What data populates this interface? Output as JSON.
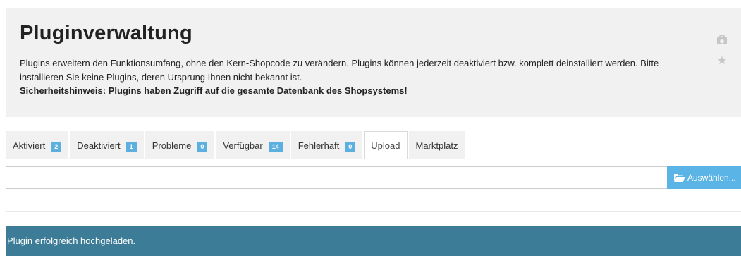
{
  "header": {
    "title": "Pluginverwaltung",
    "description": "Plugins erweitern den Funktionsumfang, ohne den Kern-Shopcode zu verändern. Plugins können jederzeit deaktiviert bzw. komplett deinstalliert werden. Bitte installieren Sie keine Plugins, deren Ursprung Ihnen nicht bekannt ist.",
    "warning": "Sicherheitshinweis: Plugins haben Zugriff auf die gesamte Datenbank des Shopsystems!",
    "icons": [
      "help-icon",
      "star-icon"
    ]
  },
  "tabs": [
    {
      "label": "Aktiviert",
      "count": "2"
    },
    {
      "label": "Deaktiviert",
      "count": "1"
    },
    {
      "label": "Probleme",
      "count": "0"
    },
    {
      "label": "Verfügbar",
      "count": "14"
    },
    {
      "label": "Fehlerhaft",
      "count": "0"
    },
    {
      "label": "Upload",
      "active": true
    },
    {
      "label": "Marktplatz"
    }
  ],
  "upload": {
    "file_value": "",
    "button_label": "Auswählen...",
    "button_icon": "folder-open-icon"
  },
  "alert": {
    "message": "Plugin erfolgreich hochgeladen."
  },
  "colors": {
    "badge": "#5cb0e0",
    "button": "#5ab4e6",
    "alert": "#3d7c97",
    "panel": "#f1f1f1"
  }
}
